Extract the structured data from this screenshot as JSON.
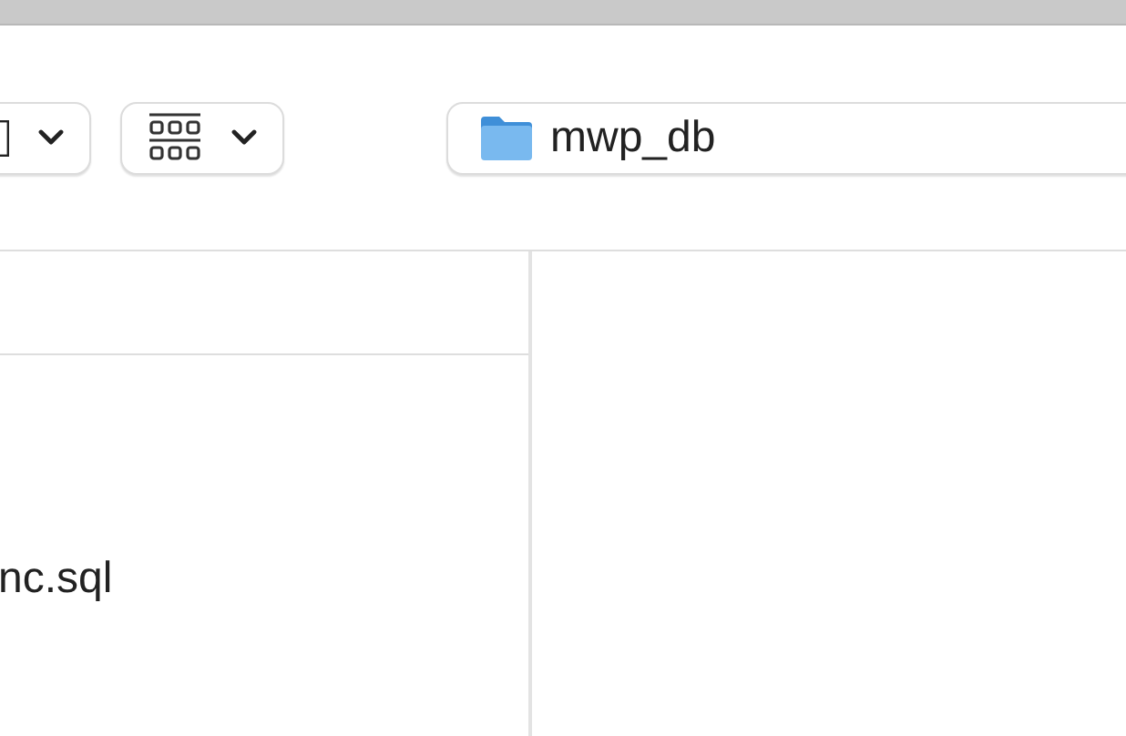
{
  "path_bar": {
    "folder": "mwp_db"
  },
  "files": [
    {
      "name": "nc.sql"
    }
  ]
}
